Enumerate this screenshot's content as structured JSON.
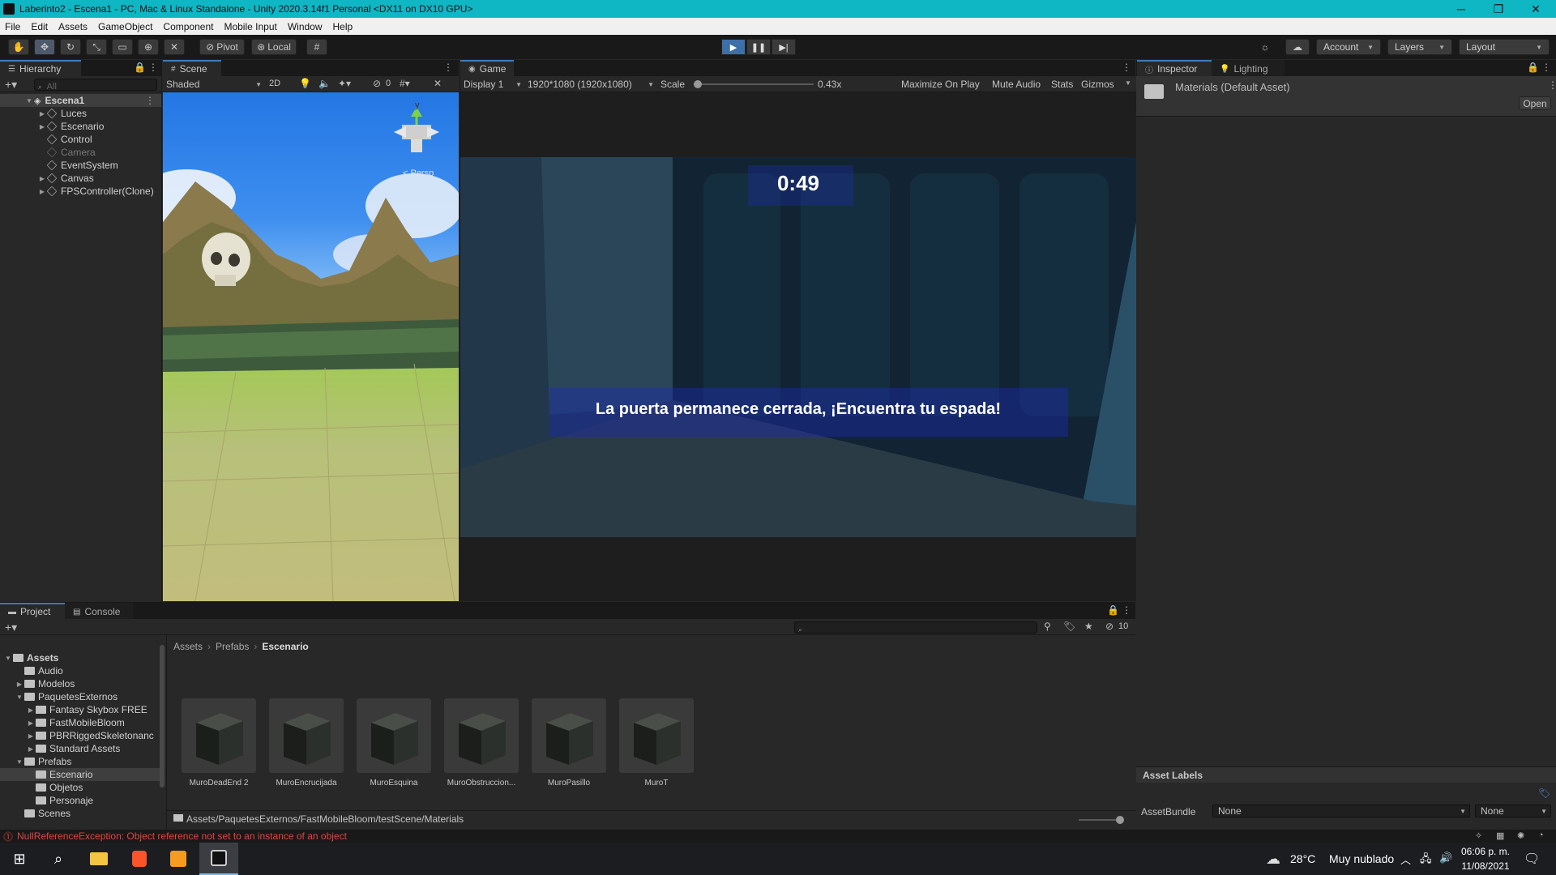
{
  "window": {
    "title": "Laberinto2 - Escena1 - PC, Mac & Linux Standalone - Unity 2020.3.14f1 Personal <DX11 on DX10 GPU>",
    "minimize": "─",
    "restore": "❐",
    "close": "✕"
  },
  "menu": [
    "File",
    "Edit",
    "Assets",
    "GameObject",
    "Component",
    "Mobile Input",
    "Window",
    "Help"
  ],
  "toolbar": {
    "pivot": "Pivot",
    "local": "Local",
    "account": "Account",
    "layers": "Layers",
    "layout": "Layout"
  },
  "hierarchy": {
    "tab": "Hierarchy",
    "search_placeholder": "All",
    "scene": "Escena1",
    "items": [
      {
        "label": "Luces",
        "expandable": true,
        "dim": false
      },
      {
        "label": "Escenario",
        "expandable": true,
        "dim": false
      },
      {
        "label": "Control",
        "expandable": false,
        "dim": false
      },
      {
        "label": "Camera",
        "expandable": false,
        "dim": true
      },
      {
        "label": "EventSystem",
        "expandable": false,
        "dim": false
      },
      {
        "label": "Canvas",
        "expandable": true,
        "dim": false
      },
      {
        "label": "FPSController(Clone)",
        "expandable": true,
        "dim": false
      }
    ]
  },
  "scene": {
    "tab": "Scene",
    "shading": "Shaded",
    "mode_2d": "2D",
    "hidden_count": "0",
    "gizmo_y": "y",
    "persp": "< Persp"
  },
  "game": {
    "tab": "Game",
    "display": "Display 1",
    "resolution": "1920*1080 (1920x1080)",
    "scale_label": "Scale",
    "scale_value": "0.43x",
    "scale_fraction": 0.0,
    "maximize_on_play": "Maximize On Play",
    "mute_audio": "Mute Audio",
    "stats": "Stats",
    "gizmos": "Gizmos",
    "timer": "0:49",
    "message": "La puerta permanece cerrada, ¡Encuentra tu espada!"
  },
  "inspector": {
    "tab": "Inspector",
    "lighting_tab": "Lighting",
    "asset_title": "Materials (Default Asset)",
    "open_button": "Open",
    "asset_labels": "Asset Labels",
    "assetbundle_label": "AssetBundle",
    "assetbundle_value": "None",
    "variant_value": "None"
  },
  "project": {
    "tab": "Project",
    "console_tab": "Console",
    "hidden_count": "10",
    "breadcrumb": [
      "Assets",
      "Prefabs",
      "Escenario"
    ],
    "tree": [
      {
        "label": "Assets",
        "level": 0,
        "expandable": true,
        "bold": true
      },
      {
        "label": "Audio",
        "level": 1,
        "expandable": false
      },
      {
        "label": "Modelos",
        "level": 1,
        "expandable": true
      },
      {
        "label": "PaquetesExternos",
        "level": 1,
        "expandable": true
      },
      {
        "label": "Fantasy Skybox FREE",
        "level": 2,
        "expandable": true
      },
      {
        "label": "FastMobileBloom",
        "level": 2,
        "expandable": true
      },
      {
        "label": "PBRRiggedSkeletonanc",
        "level": 2,
        "expandable": true
      },
      {
        "label": "Standard Assets",
        "level": 2,
        "expandable": true
      },
      {
        "label": "Prefabs",
        "level": 1,
        "expandable": true
      },
      {
        "label": "Escenario",
        "level": 2,
        "expandable": false,
        "selected": true
      },
      {
        "label": "Objetos",
        "level": 2,
        "expandable": false
      },
      {
        "label": "Personaje",
        "level": 2,
        "expandable": false
      },
      {
        "label": "Scenes",
        "level": 1,
        "expandable": false
      }
    ],
    "assets": [
      "MuroDeadEnd 2",
      "MuroEncrucijada",
      "MuroEsquina",
      "MuroObstruccion...",
      "MuroPasillo",
      "MuroT"
    ],
    "footer_path": "Assets/PaquetesExternos/FastMobileBloom/testScene/Materials"
  },
  "status": {
    "error": "NullReferenceException: Object reference not set to an instance of an object"
  },
  "taskbar": {
    "weather_temp": "28°C",
    "weather_desc": "Muy nublado",
    "time": "06:06 p. m.",
    "date": "11/08/2021"
  },
  "colors": {
    "titlebar": "#0fb6c4",
    "accent": "#3a79bb",
    "error": "#e04444"
  }
}
